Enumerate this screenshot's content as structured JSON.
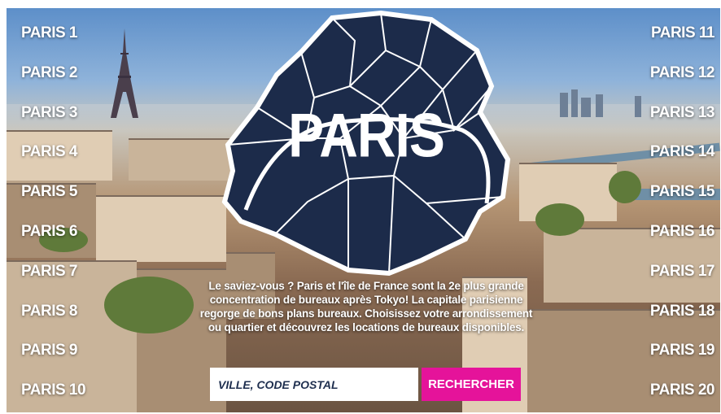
{
  "left_links": [
    "PARIS 1",
    "PARIS 2",
    "PARIS 3",
    "PARIS 4",
    "PARIS 5",
    "PARIS 6",
    "PARIS 7",
    "PARIS 8",
    "PARIS 9",
    "PARIS 10"
  ],
  "right_links": [
    "PARIS 11",
    "PARIS 12",
    "PARIS 13",
    "PARIS 14",
    "PARIS 15",
    "PARIS 16",
    "PARIS 17",
    "PARIS 18",
    "PARIS 19",
    "PARIS 20"
  ],
  "map": {
    "title": "PARIS",
    "fill_color": "#1c2b4a"
  },
  "blurb": "Le saviez-vous ? Paris et l'île de France sont la 2e plus grande concentration de bureaux après Tokyo! La capitale parisienne regorge de bons plans bureaux. Choisissez votre arrondissement ou quartier et découvrez les locations de bureaux disponibles.",
  "search": {
    "placeholder": "VILLE, CODE POSTAL",
    "button_label": "RECHERCHER",
    "button_color": "#e5139a"
  }
}
